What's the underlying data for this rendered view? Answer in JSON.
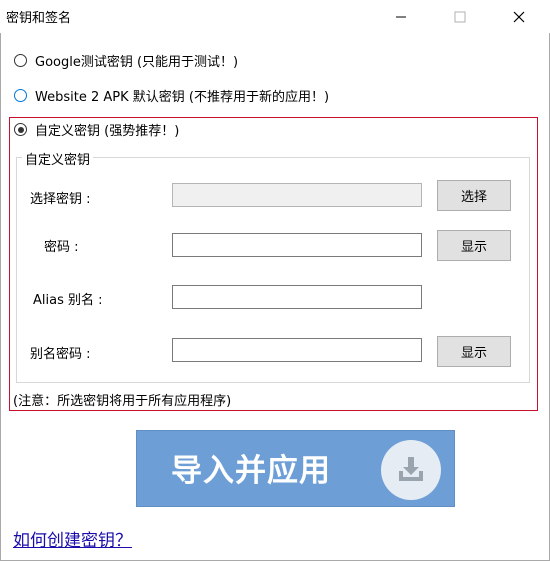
{
  "window": {
    "title": "密钥和签名",
    "controls": {
      "minimize": "minimize-icon",
      "maximize": "maximize-icon",
      "close": "close-icon"
    }
  },
  "key_options": [
    {
      "label": "Google测试密钥 (只能用于测试！)",
      "selected": false
    },
    {
      "label": "Website 2 APK 默认密钥 (不推荐用于新的应用！)",
      "selected": false,
      "focused": true
    },
    {
      "label": "自定义密钥 (强势推荐！)",
      "selected": true
    }
  ],
  "custom_key": {
    "group_title": "自定义密钥",
    "select_key": {
      "label": "选择密钥 :",
      "value": "",
      "button": "选择"
    },
    "password": {
      "label": "密码 :",
      "value": "",
      "button": "显示"
    },
    "alias": {
      "label": "Alias 别名 :",
      "value": ""
    },
    "alias_password": {
      "label": "别名密码 :",
      "value": "",
      "button": "显示"
    },
    "note": "(注意：所选密钥将用于所有应用程序)"
  },
  "apply_button": {
    "label": "导入并应用",
    "icon": "download-tray-icon"
  },
  "help_link": "如何创建密钥？",
  "colors": {
    "highlight_frame": "#c8102e",
    "apply_button": "#6d9fd6",
    "link": "#1a0dab",
    "focus_radio": "#0078d7"
  }
}
